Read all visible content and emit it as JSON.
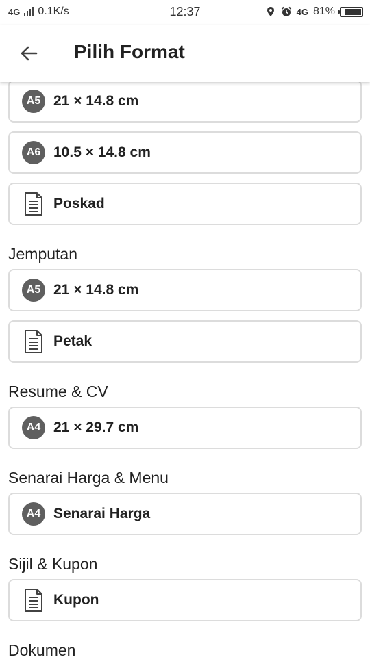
{
  "status_bar": {
    "network": "4G",
    "speed": "0.1K/s",
    "time": "12:37",
    "data_type": "4G",
    "battery": "81%"
  },
  "app_bar": {
    "title": "Pilih Format",
    "back_icon": "arrow-left-icon"
  },
  "list": {
    "items": [
      {
        "kind": "card",
        "badge": "A5",
        "label": "21 × 14.8 cm"
      },
      {
        "kind": "card",
        "badge": "A6",
        "label": "10.5 × 14.8 cm"
      },
      {
        "kind": "card",
        "icon": "document-icon",
        "label": "Poskad"
      },
      {
        "kind": "section",
        "label": "Jemputan"
      },
      {
        "kind": "card",
        "badge": "A5",
        "label": "21 × 14.8 cm"
      },
      {
        "kind": "card",
        "icon": "document-icon",
        "label": "Petak"
      },
      {
        "kind": "section",
        "label": "Resume & CV"
      },
      {
        "kind": "card",
        "badge": "A4",
        "label": "21 × 29.7 cm"
      },
      {
        "kind": "section",
        "label": "Senarai Harga & Menu"
      },
      {
        "kind": "card",
        "badge": "A4",
        "label": "Senarai Harga"
      },
      {
        "kind": "section",
        "label": "Sijil & Kupon"
      },
      {
        "kind": "card",
        "icon": "document-icon",
        "label": "Kupon"
      },
      {
        "kind": "section",
        "label": "Dokumen"
      }
    ]
  },
  "colors": {
    "badge": "#5f5f5f",
    "card_border": "#dcdcdc",
    "text": "#212121"
  }
}
